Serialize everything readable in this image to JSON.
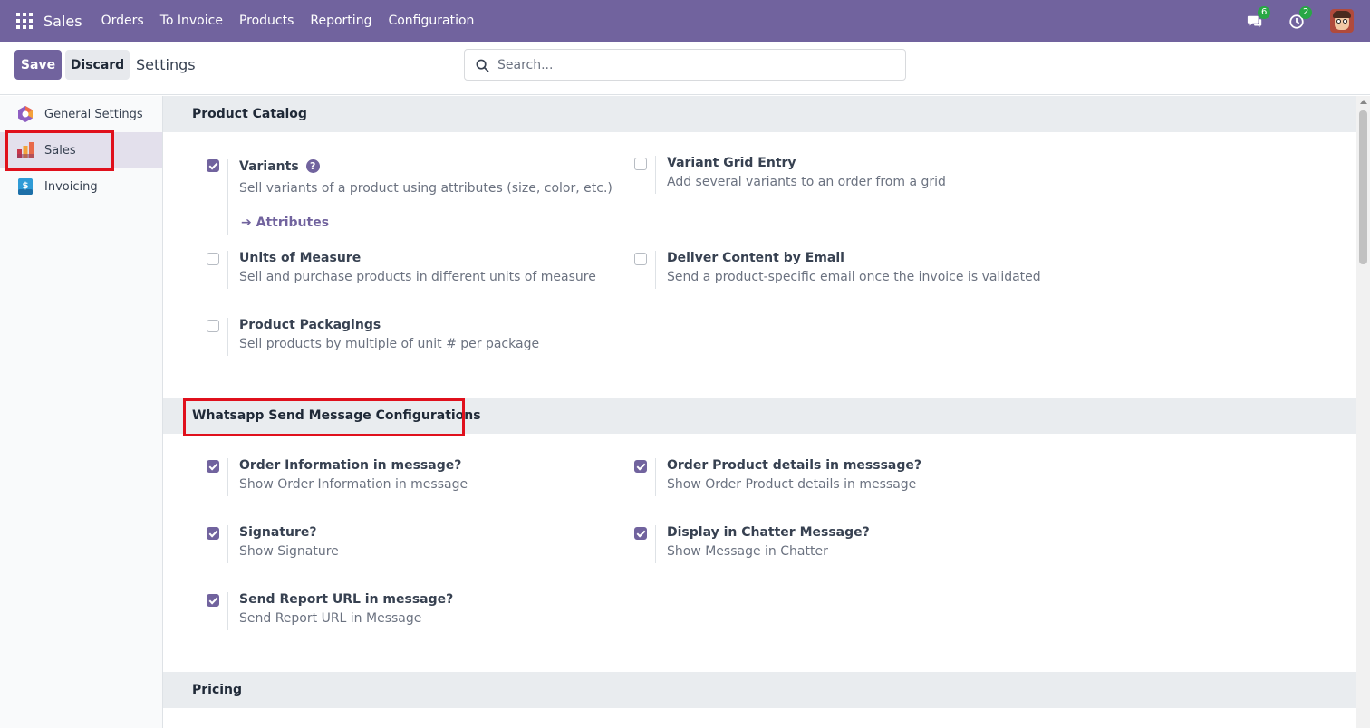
{
  "navbar": {
    "brand": "Sales",
    "menu": [
      "Orders",
      "To Invoice",
      "Products",
      "Reporting",
      "Configuration"
    ],
    "messages_count": "6",
    "activities_count": "2",
    "color": "#71639e"
  },
  "control": {
    "save_label": "Save",
    "discard_label": "Discard",
    "title": "Settings",
    "search_placeholder": "Search..."
  },
  "sidebar": {
    "items": [
      {
        "label": "General Settings",
        "icon": "general-settings-icon"
      },
      {
        "label": "Sales",
        "icon": "sales-app-icon",
        "active": true
      },
      {
        "label": "Invoicing",
        "icon": "invoicing-app-icon"
      }
    ]
  },
  "sections": {
    "product_catalog": {
      "title": "Product Catalog",
      "settings": [
        {
          "title": "Variants",
          "desc": "Sell variants of a product using attributes (size, color, etc.)",
          "checked": true,
          "link": "Attributes"
        },
        {
          "title": "Variant Grid Entry",
          "desc": "Add several variants to an order from a grid",
          "checked": false
        },
        {
          "title": "Units of Measure",
          "desc": "Sell and purchase products in different units of measure",
          "checked": false
        },
        {
          "title": "Deliver Content by Email",
          "desc": "Send a product-specific email once the invoice is validated",
          "checked": false
        },
        {
          "title": "Product Packagings",
          "desc": "Sell products by multiple of unit # per package",
          "checked": false
        }
      ]
    },
    "whatsapp": {
      "title": "Whatsapp Send Message Configurations",
      "settings": [
        {
          "title": "Order Information in message?",
          "desc": "Show Order Information in message",
          "checked": true
        },
        {
          "title": "Order Product details in messsage?",
          "desc": "Show Order Product details in message",
          "checked": true
        },
        {
          "title": "Signature?",
          "desc": "Show Signature",
          "checked": true
        },
        {
          "title": "Display in Chatter Message?",
          "desc": "Show Message in Chatter",
          "checked": true
        },
        {
          "title": "Send Report URL in message?",
          "desc": "Send Report URL in Message",
          "checked": true
        }
      ]
    },
    "pricing": {
      "title": "Pricing"
    }
  },
  "colors": {
    "accent": "#71639e",
    "highlight": "#e0101c",
    "section_bg": "#e9ecef"
  }
}
